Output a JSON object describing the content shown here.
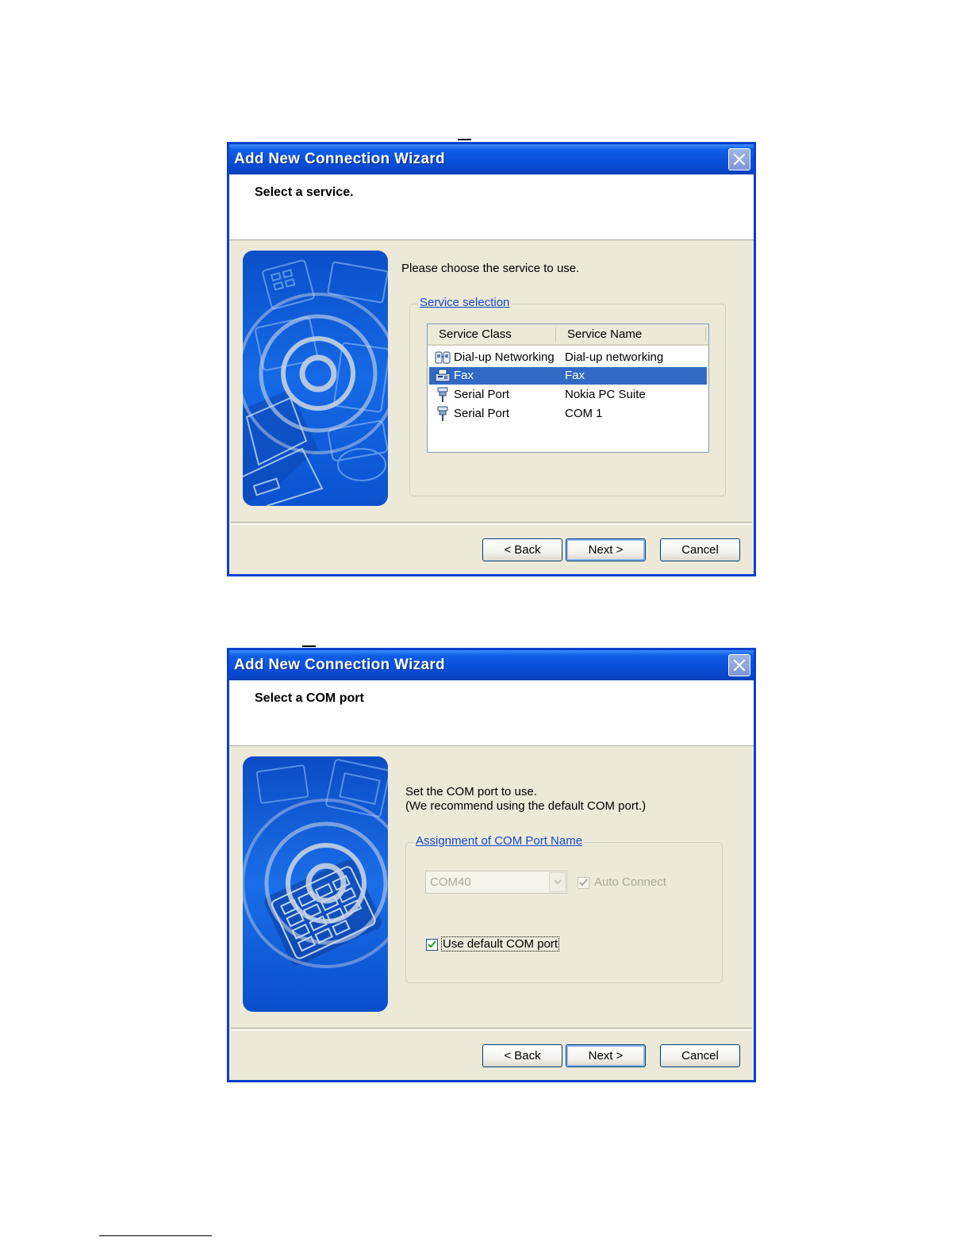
{
  "dialog1": {
    "title": "Add New Connection Wizard",
    "header": "Select a service.",
    "description": "Please choose the service to use.",
    "group_label": "Service selection",
    "columns": [
      "Service Class",
      "Service Name"
    ],
    "rows": [
      {
        "class": "Dial-up Networking",
        "name": "Dial-up networking",
        "icon": "dialup-phone-icon",
        "selected": false
      },
      {
        "class": "Fax",
        "name": "Fax",
        "icon": "fax-icon",
        "selected": true
      },
      {
        "class": "Serial Port",
        "name": "Nokia PC Suite",
        "icon": "serial-port-icon",
        "selected": false
      },
      {
        "class": "Serial Port",
        "name": "COM 1",
        "icon": "serial-port-icon",
        "selected": false
      }
    ],
    "buttons": {
      "back": "< Back",
      "next": "Next >",
      "cancel": "Cancel"
    }
  },
  "dialog2": {
    "title": "Add New Connection Wizard",
    "header": "Select a COM port",
    "description_line1": "Set the COM port to use.",
    "description_line2": "(We recommend using the default COM port.)",
    "group_label": "Assignment of COM Port Name",
    "combo_value": "COM40",
    "auto_connect_label": "Auto Connect",
    "auto_connect_checked": true,
    "use_default_label": "Use default COM port",
    "use_default_checked": true,
    "buttons": {
      "back": "< Back",
      "next": "Next >",
      "cancel": "Cancel"
    }
  },
  "colors": {
    "titlebar": "#0A4FD9",
    "selection": "#316AC5",
    "dialog_face": "#ECE9D8",
    "group_label": "#1747C6"
  }
}
